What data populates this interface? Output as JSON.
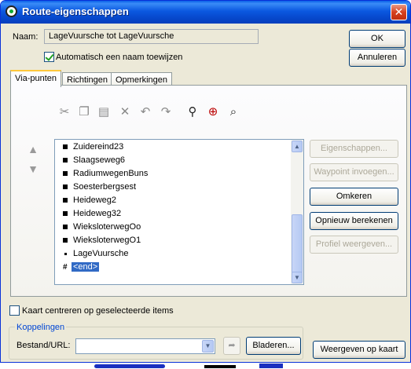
{
  "window": {
    "title": "Route-eigenschappen",
    "close_glyph": "✕"
  },
  "name_row": {
    "label": "Naam:",
    "value": "LageVuursche tot LageVuursche"
  },
  "auto_name": {
    "label": "Automatisch een naam toewijzen",
    "checked": true
  },
  "buttons": {
    "ok": "OK",
    "cancel": "Annuleren"
  },
  "tabs": [
    {
      "label": "Via-punten",
      "active": true
    },
    {
      "label": "Richtingen",
      "active": false
    },
    {
      "label": "Opmerkingen",
      "active": false
    }
  ],
  "toolbar": {
    "icons": [
      "cut-icon",
      "copy-icon",
      "paste-icon",
      "delete-icon",
      "undo-icon",
      "redo-icon",
      "find-icon",
      "find-target-icon",
      "find-route-icon"
    ]
  },
  "waypoints": [
    {
      "label": "Zuidereind23",
      "marker": "square"
    },
    {
      "label": "Slaagseweg6",
      "marker": "square"
    },
    {
      "label": "RadiumwegenBuns",
      "marker": "square"
    },
    {
      "label": "Soesterbergsest",
      "marker": "square"
    },
    {
      "label": "Heideweg2",
      "marker": "square"
    },
    {
      "label": "Heideweg32",
      "marker": "square"
    },
    {
      "label": "WieksloterwegOo",
      "marker": "square"
    },
    {
      "label": "WieksloterwegO1",
      "marker": "square"
    },
    {
      "label": "LageVuursche",
      "marker": "dot"
    },
    {
      "label": "<end>",
      "marker": "hash",
      "selected": true
    }
  ],
  "side_buttons": {
    "properties": "Eigenschappen...",
    "insert_waypoint": "Waypoint invoegen...",
    "reverse": "Omkeren",
    "recalculate": "Opnieuw berekenen",
    "show_profile": "Profiel weergeven..."
  },
  "center_map": {
    "label": "Kaart centreren op geselecteerde items",
    "checked": false
  },
  "links_group": {
    "title": "Koppelingen",
    "file_label": "Bestand/URL:",
    "file_value": "",
    "browse": "Bladeren..."
  },
  "show_on_map": "Weergeven op kaart",
  "colors": {
    "titlebar": "#0a58e0",
    "dialog": "#ece9d8",
    "selection": "#316ac5"
  }
}
